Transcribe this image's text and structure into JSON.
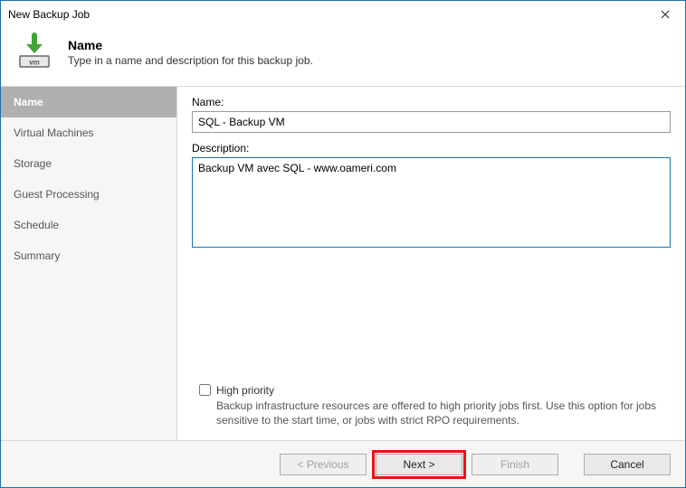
{
  "window": {
    "title": "New Backup Job"
  },
  "header": {
    "title": "Name",
    "subtitle": "Type in a name and description for this backup job."
  },
  "steps": [
    {
      "label": "Name",
      "active": true
    },
    {
      "label": "Virtual Machines",
      "active": false
    },
    {
      "label": "Storage",
      "active": false
    },
    {
      "label": "Guest Processing",
      "active": false
    },
    {
      "label": "Schedule",
      "active": false
    },
    {
      "label": "Summary",
      "active": false
    }
  ],
  "form": {
    "name_label": "Name:",
    "name_value": "SQL - Backup VM",
    "description_label": "Description:",
    "description_value": "Backup VM avec SQL - www.oameri.com",
    "high_priority_label": "High priority",
    "high_priority_checked": false,
    "high_priority_help": "Backup infrastructure resources are offered to high priority jobs first. Use this option for jobs sensitive to the start time, or jobs with strict RPO requirements."
  },
  "footer": {
    "previous": "< Previous",
    "next": "Next >",
    "finish": "Finish",
    "cancel": "Cancel"
  }
}
